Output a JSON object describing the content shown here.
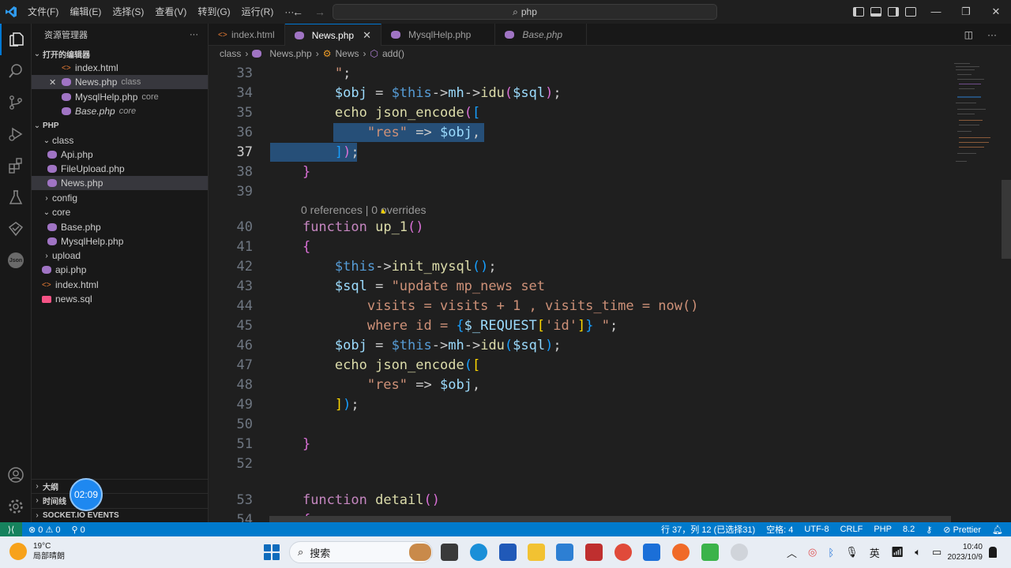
{
  "menu": [
    "文件(F)",
    "编辑(E)",
    "选择(S)",
    "查看(V)",
    "转到(G)",
    "运行(R)",
    "···"
  ],
  "search": {
    "text": "php"
  },
  "sidebar": {
    "title": "资源管理器",
    "more": "···",
    "open_editors_label": "打开的编辑器",
    "open_editors": [
      {
        "name": "index.html",
        "desc": ""
      },
      {
        "name": "News.php",
        "desc": "class",
        "close": "✕"
      },
      {
        "name": "MysqlHelp.php",
        "desc": "core"
      },
      {
        "name": "Base.php",
        "desc": "core"
      }
    ],
    "project_label": "PHP",
    "tree": {
      "class": "class",
      "api": "Api.php",
      "fileupload": "FileUpload.php",
      "news": "News.php",
      "config": "config",
      "core": "core",
      "base": "Base.php",
      "mysqlhelp": "MysqlHelp.php",
      "upload": "upload",
      "apiphp": "api.php",
      "indexhtml": "index.html",
      "newssql": "news.sql"
    },
    "outline_label": "大纲",
    "timeline_label": "时间线",
    "socket_label": "SOCKET.IO EVENTS"
  },
  "timer": "02:09",
  "tabs": [
    {
      "label": "index.html"
    },
    {
      "label": "News.php",
      "close": "✕"
    },
    {
      "label": "MysqlHelp.php"
    },
    {
      "label": "Base.php"
    }
  ],
  "breadcrumb": {
    "folder": "class",
    "file": "News.php",
    "class": "News",
    "method": "add()"
  },
  "editor": {
    "line_numbers": [
      "33",
      "34",
      "35",
      "36",
      "37",
      "38",
      "39",
      "40",
      "41",
      "42",
      "43",
      "44",
      "45",
      "46",
      "47",
      "48",
      "49",
      "50",
      "51",
      "52",
      "53",
      "54"
    ],
    "codelens": "0 references | 0 overrides"
  },
  "statusbar": {
    "errors": "⊗ 0 ⚠ 0",
    "ports": "⚲ 0",
    "position": "行 37，列 12 (已选择31)",
    "spaces": "空格: 4",
    "encoding": "UTF-8",
    "eol": "CRLF",
    "language": "PHP",
    "version": "8.2",
    "prettier": "⊘ Prettier"
  },
  "taskbar": {
    "temp": "19°C",
    "weather": "局部晴朗",
    "search": "搜索",
    "ime": "英",
    "time": "10:40",
    "date": "2023/10/9"
  },
  "colors": {
    "accent": "#007acc",
    "selection": "#264f78",
    "keyword": "#c586c0",
    "function": "#dcdcaa",
    "variable": "#9cdcfe",
    "string": "#ce9178"
  }
}
